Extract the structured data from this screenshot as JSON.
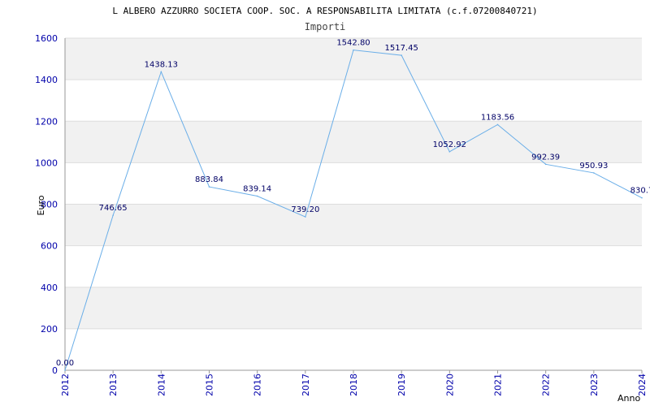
{
  "chart_data": {
    "type": "line",
    "title": "L ALBERO AZZURRO SOCIETA COOP. SOC. A RESPONSABILITA LIMITATA (c.f.07200840721)",
    "subtitle": "Importi",
    "xlabel": "Anno",
    "ylabel": "Euro",
    "ylim": [
      0,
      1600
    ],
    "yticks": [
      0,
      200,
      400,
      600,
      800,
      1000,
      1200,
      1400,
      1600
    ],
    "grid": true,
    "categories": [
      "2012",
      "2013",
      "2014",
      "2015",
      "2016",
      "2017",
      "2018",
      "2019",
      "2020",
      "2021",
      "2022",
      "2023",
      "2024"
    ],
    "series": [
      {
        "values": [
          0.0,
          746.65,
          1438.13,
          883.84,
          839.14,
          739.2,
          1542.8,
          1517.45,
          1052.92,
          1183.56,
          992.39,
          950.93,
          830.7
        ],
        "labels": [
          "0.00",
          "746.65",
          "1438.13",
          "883.84",
          "839.14",
          "739.20",
          "1542.80",
          "1517.45",
          "1052.92",
          "1183.56",
          "992.39",
          "950.93",
          "830.7"
        ]
      }
    ],
    "colors": {
      "line": "#6aaee8",
      "band": "#f1f1f1",
      "grid": "#dddddd",
      "tick_text": "#0000aa",
      "label_text": "#000066"
    }
  }
}
